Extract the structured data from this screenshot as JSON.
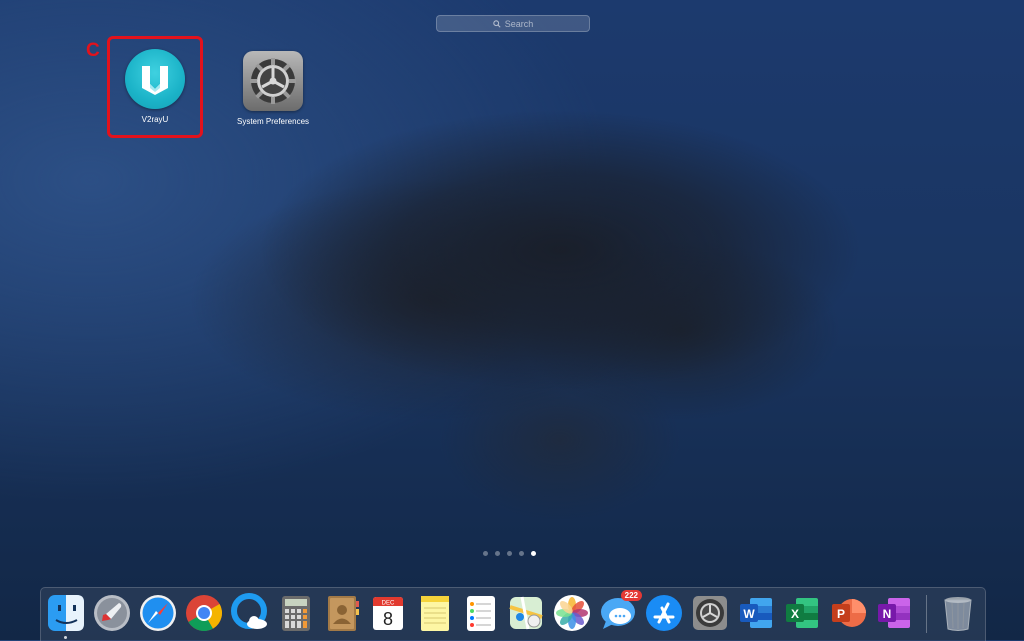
{
  "search": {
    "placeholder": "Search"
  },
  "apps": [
    {
      "name": "V2rayU"
    },
    {
      "name": "System Preferences"
    }
  ],
  "annotation": {
    "letter": "C",
    "color": "#e3121c"
  },
  "page_indicator": {
    "total": 5,
    "current": 5
  },
  "dock": {
    "items": [
      {
        "name": "Finder",
        "icon": "finder-icon"
      },
      {
        "name": "Launchpad",
        "icon": "launchpad-icon"
      },
      {
        "name": "Safari",
        "icon": "safari-icon"
      },
      {
        "name": "Google Chrome",
        "icon": "chrome-icon"
      },
      {
        "name": "QQ Browser",
        "icon": "browser-cloud-icon"
      },
      {
        "name": "Calculator",
        "icon": "calculator-icon"
      },
      {
        "name": "Contacts",
        "icon": "contacts-icon"
      },
      {
        "name": "Calendar",
        "icon": "calendar-icon",
        "month": "DEC",
        "day": "8"
      },
      {
        "name": "Notes",
        "icon": "notes-icon"
      },
      {
        "name": "Reminders",
        "icon": "reminders-icon"
      },
      {
        "name": "Maps",
        "icon": "maps-icon"
      },
      {
        "name": "Photos",
        "icon": "photos-icon"
      },
      {
        "name": "Messages",
        "icon": "messages-icon",
        "badge": "222"
      },
      {
        "name": "App Store",
        "icon": "app-store-icon"
      },
      {
        "name": "System Preferences",
        "icon": "gear-icon"
      },
      {
        "name": "Microsoft Word",
        "icon": "word-icon",
        "letter": "W"
      },
      {
        "name": "Microsoft Excel",
        "icon": "excel-icon",
        "letter": "X"
      },
      {
        "name": "Microsoft PowerPoint",
        "icon": "powerpoint-icon",
        "letter": "P"
      },
      {
        "name": "Microsoft OneNote",
        "icon": "onenote-icon",
        "letter": "N"
      },
      {
        "name": "Trash",
        "icon": "trash-icon"
      }
    ]
  }
}
